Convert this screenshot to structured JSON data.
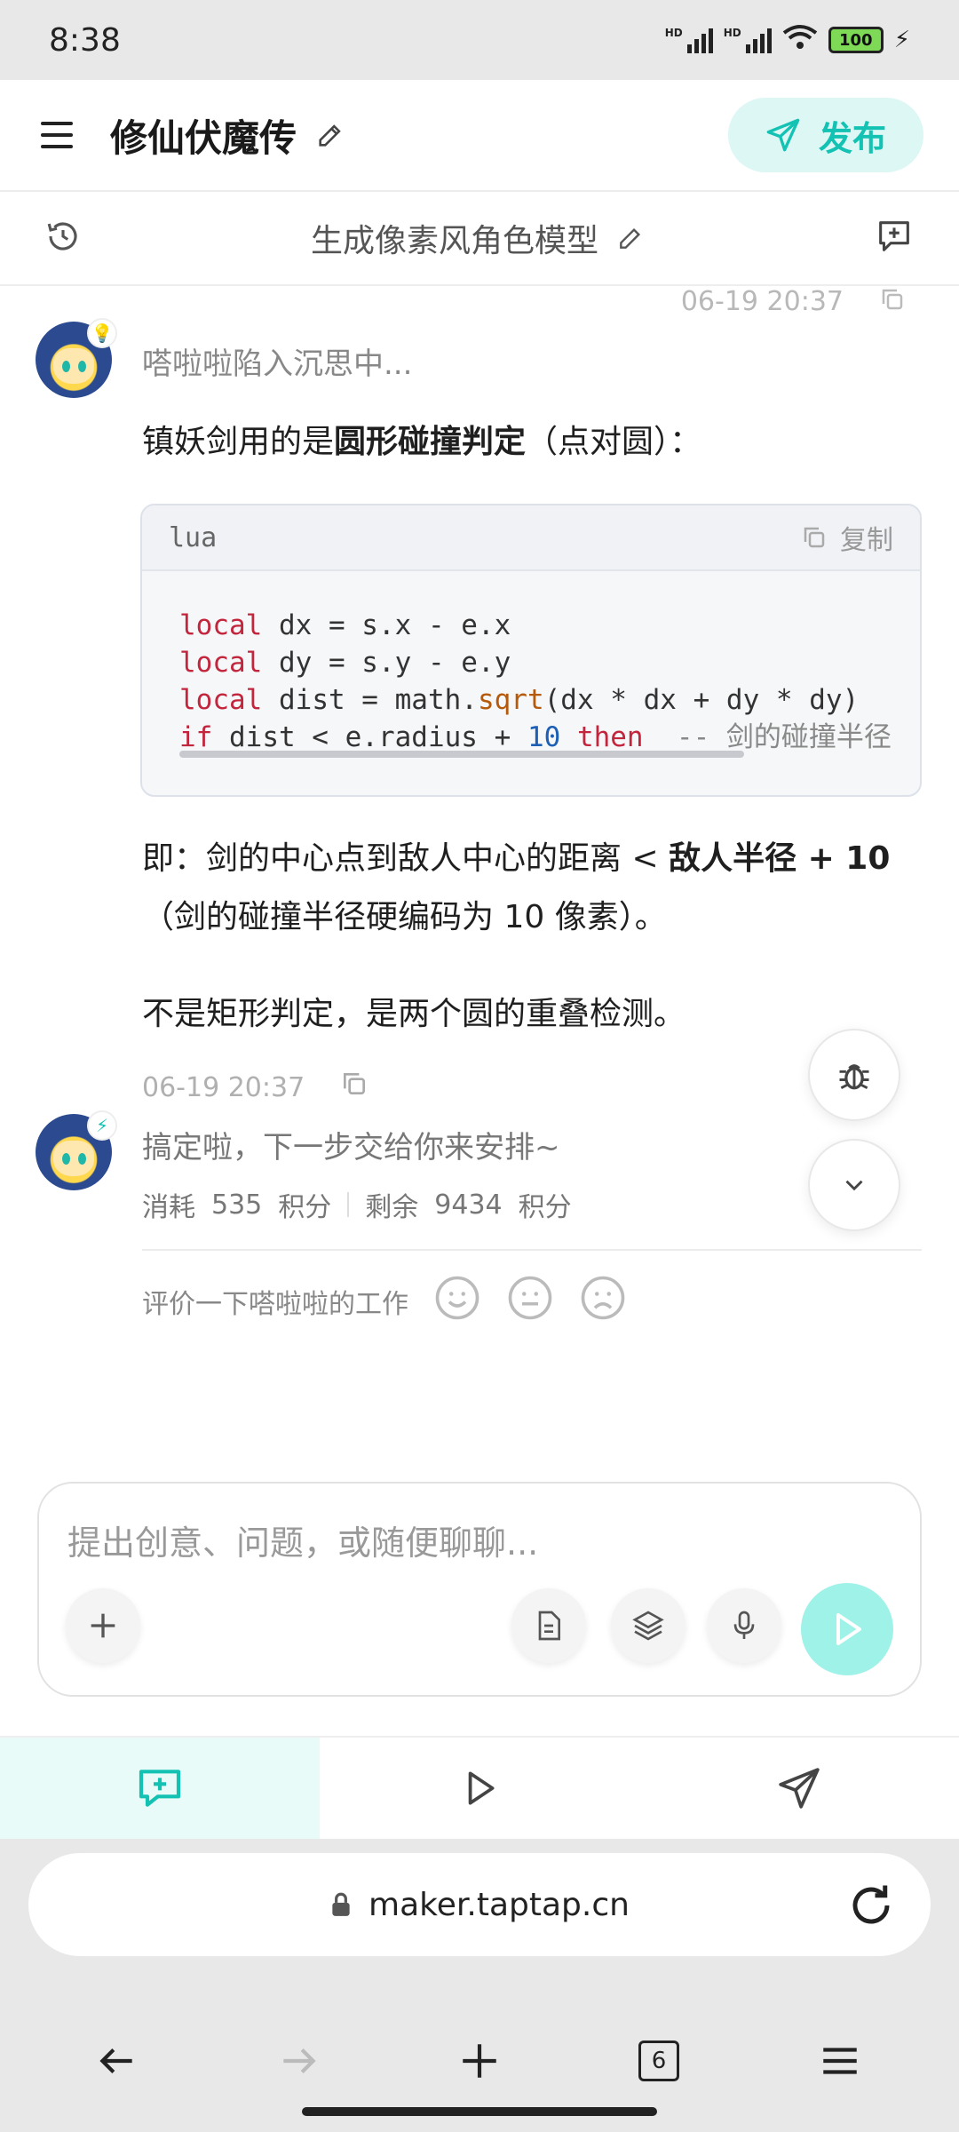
{
  "status": {
    "time": "8:38",
    "battery": "100",
    "signal_labels": [
      "HD",
      "HD"
    ]
  },
  "header": {
    "title": "修仙伏魔传",
    "publish_label": "发布"
  },
  "subheader": {
    "title": "生成像素风角色模型"
  },
  "chat": {
    "top_timestamp": "06-19 20:37",
    "thinking_text": "嗒啦啦陷入沉思中...",
    "intro_plain": "镇妖剑用的是",
    "intro_bold": "圆形碰撞判定",
    "intro_tail": "（点对圆）：",
    "code": {
      "lang": "lua",
      "copy_label": "复制",
      "lines": [
        "local dx = s.x - e.x",
        "local dy = s.y - e.y",
        "local dist = math.sqrt(dx * dx + dy * dy)",
        "if dist < e.radius + 10 then  -- 剑的碰撞半径"
      ]
    },
    "explain_1": "即：剑的中心点到敌人中心的距离 < ",
    "explain_bold": "敌人半径 + 10",
    "explain_2": "（剑的碰撞半径硬编码为 10 像素）。",
    "explain_3": "不是矩形判定，是两个圆的重叠检测。",
    "bottom_timestamp": "06-19 20:37",
    "done_text": "搞定啦，下一步交给你来安排~",
    "cost_label": "消耗",
    "cost_value": "535",
    "cost_unit": "积分",
    "remain_label": "剩余",
    "remain_value": "9434",
    "remain_unit": "积分",
    "rate_label": "评价一下嗒啦啦的工作"
  },
  "composer": {
    "placeholder": "提出创意、问题，或随便聊聊..."
  },
  "browser": {
    "url": "maker.taptap.cn",
    "tab_count": "6"
  },
  "colors": {
    "accent": "#13c2b3",
    "send_bg": "#9ff2e8",
    "publish_bg": "#dcf7f4"
  }
}
